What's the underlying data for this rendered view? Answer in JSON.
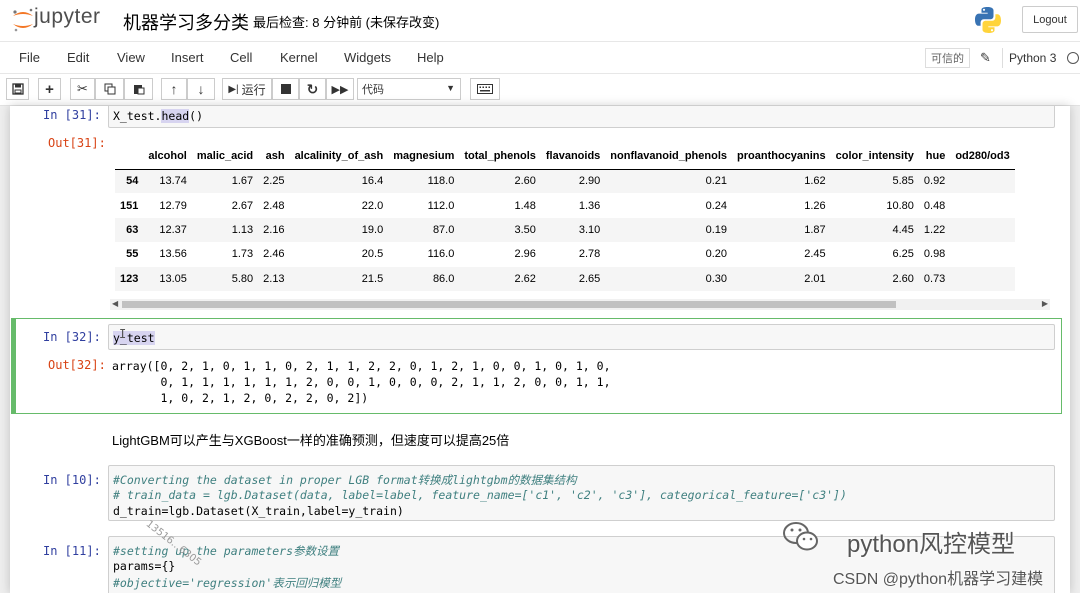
{
  "header": {
    "logo_text": "jupyter",
    "notebook_title": "机器学习多分类",
    "checkpoint_status": "最后检查: 8 分钟前  (未保存改变)",
    "logout_label": "Logout"
  },
  "menubar": {
    "items": [
      "File",
      "Edit",
      "View",
      "Insert",
      "Cell",
      "Kernel",
      "Widgets",
      "Help"
    ],
    "trusted_label": "可信的",
    "kernel_name": "Python 3"
  },
  "toolbar": {
    "run_label": "运行",
    "cell_type": "代码"
  },
  "cells": {
    "c31": {
      "in_prompt": "In  [31]:",
      "out_prompt": "Out[31]:",
      "code_prefix": "X_test.",
      "code_highlight": "head",
      "code_suffix": "()"
    },
    "c32": {
      "in_prompt": "In  [32]:",
      "out_prompt": "Out[32]:",
      "code": "y_test",
      "output_lines": [
        "array([0, 2, 1, 0, 1, 1, 0, 2, 1, 1, 2, 2, 0, 1, 2, 1, 0, 0, 1, 0, 1, 0,",
        "       0, 1, 1, 1, 1, 1, 1, 2, 0, 0, 1, 0, 0, 0, 2, 1, 1, 2, 0, 0, 1, 1,",
        "       1, 0, 2, 1, 2, 0, 2, 2, 0, 2])"
      ]
    },
    "markdown": {
      "text": "LightGBM可以产生与XGBoost一样的准确预测，但速度可以提高25倍"
    },
    "c10": {
      "in_prompt": "In  [10]:",
      "lines": [
        "#Converting the dataset in proper LGB format转换成lightgbm的数据集结构",
        "# train_data = lgb.Dataset(data, label=label, feature_name=['c1', 'c2', 'c3'], categorical_feature=['c3'])",
        "d_train=lgb.Dataset(X_train,label=y_train)"
      ]
    },
    "c11": {
      "in_prompt": "In  [11]:",
      "lines": [
        "#setting up the parameters参数设置",
        "params={}",
        "#objective='regression'表示回归模型"
      ]
    }
  },
  "dataframe": {
    "columns": [
      "",
      "alcohol",
      "malic_acid",
      "ash",
      "alcalinity_of_ash",
      "magnesium",
      "total_phenols",
      "flavanoids",
      "nonflavanoid_phenols",
      "proanthocyanins",
      "color_intensity",
      "hue",
      "od280/od3"
    ],
    "rows": [
      [
        "54",
        "13.74",
        "1.67",
        "2.25",
        "16.4",
        "118.0",
        "2.60",
        "2.90",
        "0.21",
        "1.62",
        "5.85",
        "0.92",
        ""
      ],
      [
        "151",
        "12.79",
        "2.67",
        "2.48",
        "22.0",
        "112.0",
        "1.48",
        "1.36",
        "0.24",
        "1.26",
        "10.80",
        "0.48",
        ""
      ],
      [
        "63",
        "12.37",
        "1.13",
        "2.16",
        "19.0",
        "87.0",
        "3.50",
        "3.10",
        "0.19",
        "1.87",
        "4.45",
        "1.22",
        ""
      ],
      [
        "55",
        "13.56",
        "1.73",
        "2.46",
        "20.5",
        "116.0",
        "2.96",
        "2.78",
        "0.20",
        "2.45",
        "6.25",
        "0.98",
        ""
      ],
      [
        "123",
        "13.05",
        "5.80",
        "2.13",
        "21.5",
        "86.0",
        "2.62",
        "2.65",
        "0.30",
        "2.01",
        "2.60",
        "0.73",
        ""
      ]
    ]
  },
  "watermark": {
    "diagonal_text": "13516...6305",
    "brand": "python风控模型",
    "csdn": "CSDN @python机器学习建模"
  }
}
